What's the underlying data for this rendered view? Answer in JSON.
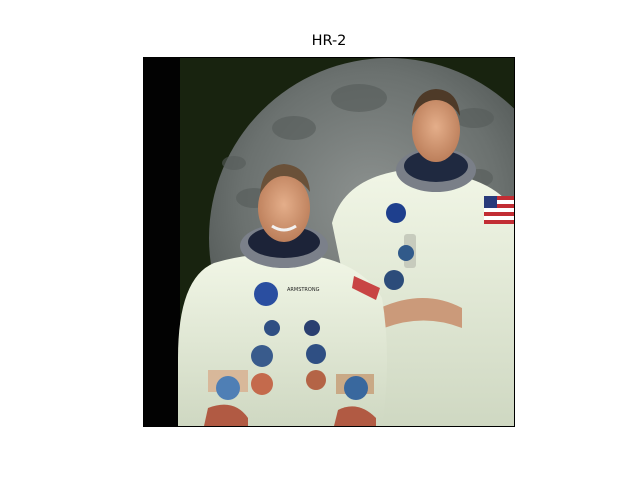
{
  "figure": {
    "title": "HR-2"
  },
  "image": {
    "subject": "photo",
    "ticks": {
      "x_count": 7,
      "y_count": 6,
      "tick_labels_visible": false
    }
  }
}
